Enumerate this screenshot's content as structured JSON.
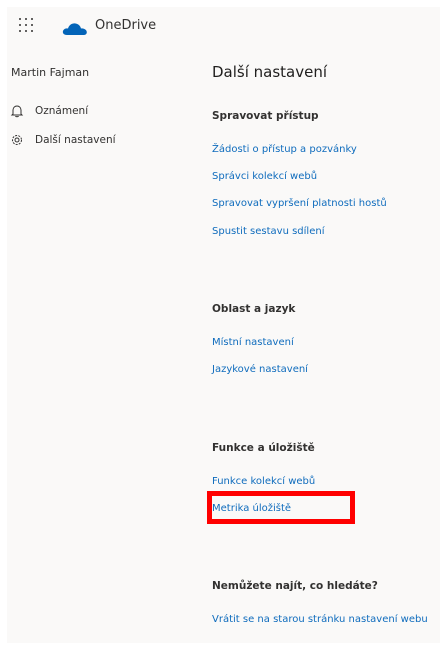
{
  "header": {
    "app_name": "OneDrive"
  },
  "sidebar": {
    "user_name": "Martin Fajman",
    "items": [
      {
        "label": "Oznámení",
        "icon": "bell-icon"
      },
      {
        "label": "Další nastavení",
        "icon": "gear-icon"
      }
    ]
  },
  "main": {
    "title": "Další nastavení",
    "sections": [
      {
        "heading": "Spravovat přístup",
        "links": [
          "Žádosti o přístup a pozvánky",
          "Správci kolekcí webů",
          "Spravovat vypršení platnosti hostů",
          "Spustit sestavu sdílení"
        ]
      },
      {
        "heading": "Oblast a jazyk",
        "links": [
          "Místní nastavení",
          "Jazykové nastavení"
        ]
      },
      {
        "heading": "Funkce a úložiště",
        "links": [
          "Funkce kolekcí webů",
          "Metrika úložiště"
        ]
      },
      {
        "heading": "Nemůžete najít, co hledáte?",
        "links": [
          "Vrátit se na starou stránku nastavení webu"
        ]
      }
    ]
  },
  "colors": {
    "link": "#0f6cbd",
    "highlight": "#ff0000",
    "brand_cloud": "#0364b8"
  }
}
